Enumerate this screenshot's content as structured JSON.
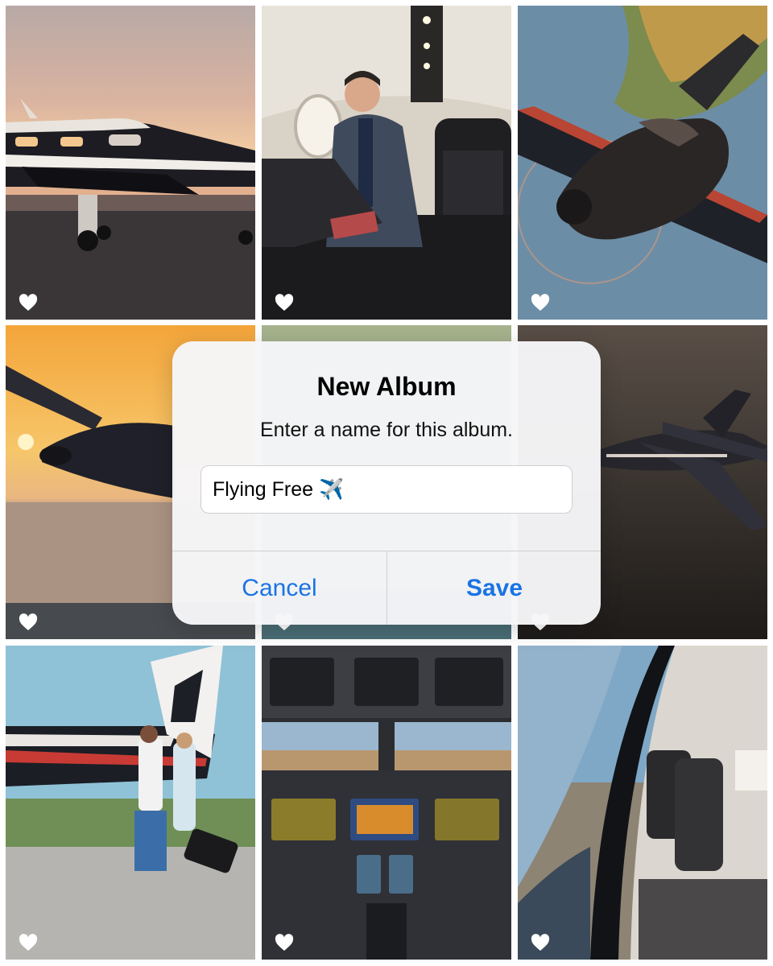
{
  "dialog": {
    "title": "New Album",
    "message": "Enter a name for this album.",
    "input_value": "Flying Free ✈️",
    "cancel_label": "Cancel",
    "save_label": "Save"
  },
  "photos": [
    {
      "subject": "plane-on-tarmac-sunset",
      "icon": "heart-icon"
    },
    {
      "subject": "businessman-in-cabin",
      "icon": "heart-icon"
    },
    {
      "subject": "plane-flying-over-coast",
      "icon": "heart-icon"
    },
    {
      "subject": "plane-flying-at-sunset",
      "icon": "heart-icon"
    },
    {
      "subject": "plane-over-field",
      "icon": "heart-icon"
    },
    {
      "subject": "plane-flying-at-dusk",
      "icon": "heart-icon"
    },
    {
      "subject": "couple-walking-by-plane",
      "icon": "heart-icon"
    },
    {
      "subject": "cockpit-instrument-panel",
      "icon": "heart-icon"
    },
    {
      "subject": "cabin-interior-seats",
      "icon": "heart-icon"
    }
  ],
  "colors": {
    "accent": "#1a74e4",
    "dialog_bg": "#f6f6f8"
  }
}
